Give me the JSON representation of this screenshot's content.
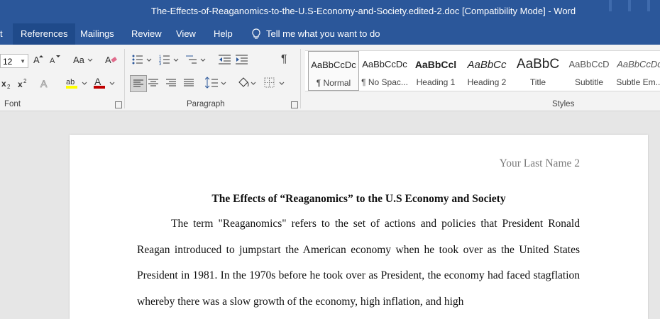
{
  "window": {
    "title": "The-Effects-of-Reaganomics-to-the-U.S-Economy-and-Society.edited-2.doc [Compatibility Mode]  -  Word"
  },
  "tabs": [
    {
      "label": "t"
    },
    {
      "label": "References"
    },
    {
      "label": "Mailings"
    },
    {
      "label": "Review"
    },
    {
      "label": "View"
    },
    {
      "label": "Help"
    }
  ],
  "tellme": {
    "label": "Tell me what you want to do"
  },
  "ribbon": {
    "font": {
      "size_value": "12",
      "group_label": "Font"
    },
    "paragraph": {
      "group_label": "Paragraph"
    },
    "styles": {
      "group_label": "Styles",
      "items": [
        {
          "sample": "AaBbCcDc",
          "name": "¶ Normal"
        },
        {
          "sample": "AaBbCcDc",
          "name": "¶ No Spac..."
        },
        {
          "sample": "AaBbCcl",
          "name": "Heading 1"
        },
        {
          "sample": "AaBbCc",
          "name": "Heading 2"
        },
        {
          "sample": "AaBbC",
          "name": "Title"
        },
        {
          "sample": "AaBbCcD",
          "name": "Subtitle"
        },
        {
          "sample": "AaBbCcDc",
          "name": "Subtle Em..."
        }
      ]
    }
  },
  "document": {
    "header": "Your Last Name 2",
    "title": "The Effects of “Reaganomics” to the U.S Economy and Society",
    "paragraph": "The term \"Reaganomics\" refers to the set of actions and policies that President Ronald Reagan introduced to jumpstart the American economy when he took over as the United States President in 1981. In the 1970s before he took over as President, the economy had faced stagflation whereby there was a slow growth of the economy, high inflation, and high"
  },
  "colors": {
    "titlebar": "#2b579a",
    "ribbon": "#f3f3f3",
    "font_color_accent": "#c00000",
    "highlight_accent": "#ffff00"
  }
}
